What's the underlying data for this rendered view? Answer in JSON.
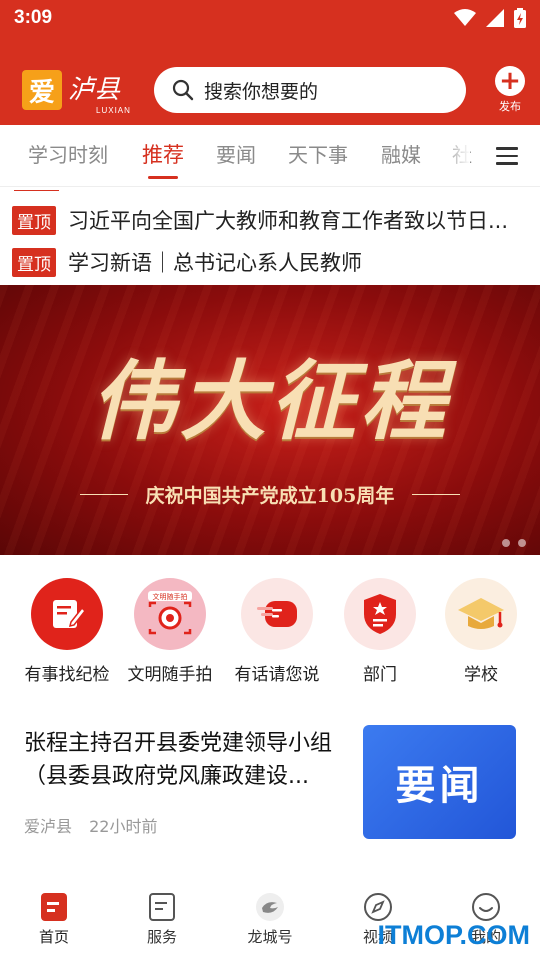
{
  "status": {
    "time": "3:09"
  },
  "header": {
    "logo_mark": "爱",
    "logo_name": "泸县",
    "logo_sub": "LUXIAN",
    "search_placeholder": "搜索你想要的",
    "publish_label": "发布"
  },
  "tabs": [
    {
      "label": "学习时刻",
      "active": false
    },
    {
      "label": "推荐",
      "active": true
    },
    {
      "label": "要闻",
      "active": false
    },
    {
      "label": "天下事",
      "active": false
    },
    {
      "label": "融媒",
      "active": false
    },
    {
      "label": "社",
      "active": false
    }
  ],
  "pinned": [
    {
      "tag": "置顶",
      "text": "习近平向全国广大教师和教育工作者致以节日..."
    },
    {
      "tag": "置顶",
      "text": "学习新语｜总书记心系人民教师"
    }
  ],
  "banner": {
    "title": "伟大征程",
    "subtitle": "庆祝中国共产党成立105周年",
    "dot_count": 2
  },
  "quick_actions": [
    {
      "label": "有事找纪检",
      "icon": "edit-icon",
      "color": "#e0231b"
    },
    {
      "label": "文明随手拍",
      "icon": "camera-icon",
      "color": "#f4b8c2",
      "badge": "文明随手拍"
    },
    {
      "label": "有话请您说",
      "icon": "message-icon",
      "color": "#fbe6e4"
    },
    {
      "label": "部门",
      "icon": "shield-icon",
      "color": "#fbe6e4"
    },
    {
      "label": "学校",
      "icon": "graduation-cap-icon",
      "color": "#fbeee0"
    }
  ],
  "news": [
    {
      "title": "张程主持召开县委党建领导小组（县委县政府党风廉政建设...",
      "source": "爱泸县",
      "time": "22小时前",
      "thumb_label": "要闻"
    }
  ],
  "bottom_nav": [
    {
      "label": "首页",
      "icon": "home-icon",
      "active": true
    },
    {
      "label": "服务",
      "icon": "service-icon",
      "active": false
    },
    {
      "label": "龙城号",
      "icon": "dragon-icon",
      "active": false
    },
    {
      "label": "视频",
      "icon": "compass-icon",
      "active": false
    },
    {
      "label": "我的",
      "icon": "smile-icon",
      "active": false
    }
  ],
  "watermark": "ITMOP.COM",
  "colors": {
    "brand": "#d6301f",
    "accent_blue": "#2f6ae6"
  }
}
